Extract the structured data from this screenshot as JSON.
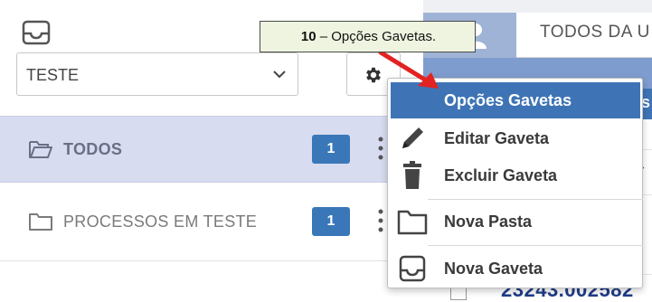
{
  "sidebar": {
    "selected_drawer": "TESTE",
    "folders": [
      {
        "label": "TODOS",
        "count": "1"
      },
      {
        "label": "PROCESSOS EM TESTE",
        "count": "1"
      }
    ]
  },
  "right_panel": {
    "tab_label": "TODOS DA U",
    "strip_char": "s",
    "row_char": "✓",
    "partial_id": "23243.002582"
  },
  "menu": {
    "items": [
      {
        "label": "Opções Gavetas",
        "icon": "none"
      },
      {
        "label": "Editar Gaveta",
        "icon": "pencil-icon"
      },
      {
        "label": "Excluir Gaveta",
        "icon": "trash-icon"
      },
      {
        "label": "Nova Pasta",
        "icon": "folder-icon"
      },
      {
        "label": "Nova Gaveta",
        "icon": "drawer-icon"
      }
    ]
  },
  "callout": {
    "number": "10",
    "text": " – Opções Gavetas."
  },
  "colors": {
    "highlight": "#3e74b5",
    "badge": "#3a77b8",
    "active_row": "#d7dcf1",
    "arrow": "#e32222",
    "callout_bg": "#eef4e0"
  }
}
